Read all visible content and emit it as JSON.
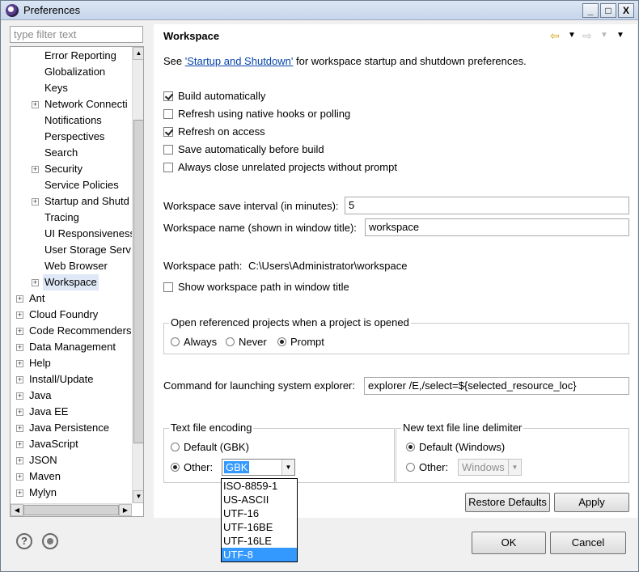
{
  "window": {
    "title": "Preferences",
    "buttons": {
      "minimize": "_",
      "maximize": "□",
      "close": "X"
    }
  },
  "filter": {
    "placeholder": "type filter text"
  },
  "tree": {
    "general_children": [
      {
        "label": "Error Reporting",
        "expandable": false
      },
      {
        "label": "Globalization",
        "expandable": false
      },
      {
        "label": "Keys",
        "expandable": false
      },
      {
        "label": "Network Connecti",
        "expandable": true
      },
      {
        "label": "Notifications",
        "expandable": false
      },
      {
        "label": "Perspectives",
        "expandable": false
      },
      {
        "label": "Search",
        "expandable": false
      },
      {
        "label": "Security",
        "expandable": true
      },
      {
        "label": "Service Policies",
        "expandable": false
      },
      {
        "label": "Startup and Shutd",
        "expandable": true
      },
      {
        "label": "Tracing",
        "expandable": false
      },
      {
        "label": "UI Responsiveness",
        "expandable": false
      },
      {
        "label": "User Storage Serv",
        "expandable": false
      },
      {
        "label": "Web Browser",
        "expandable": false
      },
      {
        "label": "Workspace",
        "expandable": true,
        "selected": true
      }
    ],
    "top_level": [
      {
        "label": "Ant"
      },
      {
        "label": "Cloud Foundry"
      },
      {
        "label": "Code Recommenders"
      },
      {
        "label": "Data Management"
      },
      {
        "label": "Help"
      },
      {
        "label": "Install/Update"
      },
      {
        "label": "Java"
      },
      {
        "label": "Java EE"
      },
      {
        "label": "Java Persistence"
      },
      {
        "label": "JavaScript"
      },
      {
        "label": "JSON"
      },
      {
        "label": "Maven"
      },
      {
        "label": "Mylyn"
      }
    ]
  },
  "page": {
    "title": "Workspace",
    "see_prefix": "See ",
    "see_link": "'Startup and Shutdown'",
    "see_suffix": " for workspace startup and shutdown preferences.",
    "options": [
      {
        "label": "Build automatically",
        "checked": true
      },
      {
        "label": "Refresh using native hooks or polling",
        "checked": false
      },
      {
        "label": "Refresh on access",
        "checked": true
      },
      {
        "label": "Save automatically before build",
        "checked": false
      },
      {
        "label": "Always close unrelated projects without prompt",
        "checked": false
      }
    ],
    "save_interval_label": "Workspace save interval (in minutes):",
    "save_interval_value": "5",
    "name_label": "Workspace name (shown in window title):",
    "name_value": "workspace",
    "path_label": "Workspace path:",
    "path_value": "C:\\Users\\Administrator\\workspace",
    "show_path_label": "Show workspace path in window title",
    "open_projects": {
      "legend": "Open referenced projects when a project is opened",
      "options": [
        "Always",
        "Never",
        "Prompt"
      ],
      "selected": "Prompt"
    },
    "command_label": "Command for launching system explorer:",
    "command_value": "explorer /E,/select=${selected_resource_loc}",
    "encoding": {
      "legend": "Text file encoding",
      "default_label": "Default (GBK)",
      "other_label": "Other:",
      "other_value": "GBK",
      "dropdown_options": [
        "ISO-8859-1",
        "US-ASCII",
        "UTF-16",
        "UTF-16BE",
        "UTF-16LE",
        "UTF-8"
      ],
      "highlighted_option": "UTF-8"
    },
    "line_delimiter": {
      "legend": "New text file line delimiter",
      "default_label": "Default (Windows)",
      "other_label": "Other:",
      "other_value": "Windows"
    },
    "restore_defaults": "Restore Defaults",
    "apply": "Apply"
  },
  "footer": {
    "help_icon": "?",
    "ok": "OK",
    "cancel": "Cancel"
  },
  "colors": {
    "selection": "#3399ff",
    "link": "#0645ad",
    "tree_selected": "#dfe8f6"
  }
}
